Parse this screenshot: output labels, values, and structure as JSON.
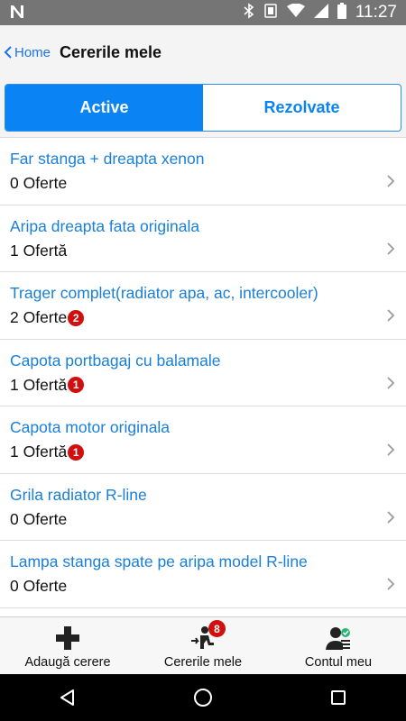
{
  "status_bar": {
    "time": "11:27"
  },
  "header": {
    "back_label": "Home",
    "title": "Cererile mele"
  },
  "segments": {
    "active_label": "Active",
    "resolved_label": "Rezolvate"
  },
  "requests": [
    {
      "title": "Far stanga + dreapta xenon",
      "offers": "0 Oferte",
      "badge": ""
    },
    {
      "title": "Aripa dreapta fata originala",
      "offers": "1 Ofertă",
      "badge": ""
    },
    {
      "title": "Trager complet(radiator apa, ac, intercooler)",
      "offers": "2 Oferte",
      "badge": "2"
    },
    {
      "title": "Capota portbagaj cu balamale",
      "offers": "1 Ofertă",
      "badge": "1"
    },
    {
      "title": "Capota motor originala",
      "offers": "1 Ofertă",
      "badge": "1"
    },
    {
      "title": "Grila radiator R-line",
      "offers": "0 Oferte",
      "badge": ""
    },
    {
      "title": "Lampa stanga spate pe aripa model R-line",
      "offers": "0 Oferte",
      "badge": ""
    }
  ],
  "tab_bar": {
    "add_label": "Adaugă cerere",
    "requests_label": "Cererile mele",
    "requests_badge": "8",
    "account_label": "Contul meu"
  },
  "colors": {
    "accent": "#0a84f5",
    "link": "#1a7fd8",
    "badge": "#d10f0f",
    "status_bar": "#757575"
  },
  "icons": {
    "status_left": "n-logo-icon",
    "status_right": [
      "bluetooth-icon",
      "mute-icon",
      "wifi-icon",
      "signal-icon",
      "battery-icon"
    ],
    "tabs": [
      "plus-icon",
      "requests-icon",
      "account-icon"
    ],
    "android_nav": [
      "back-triangle-icon",
      "home-circle-icon",
      "recents-square-icon"
    ]
  }
}
